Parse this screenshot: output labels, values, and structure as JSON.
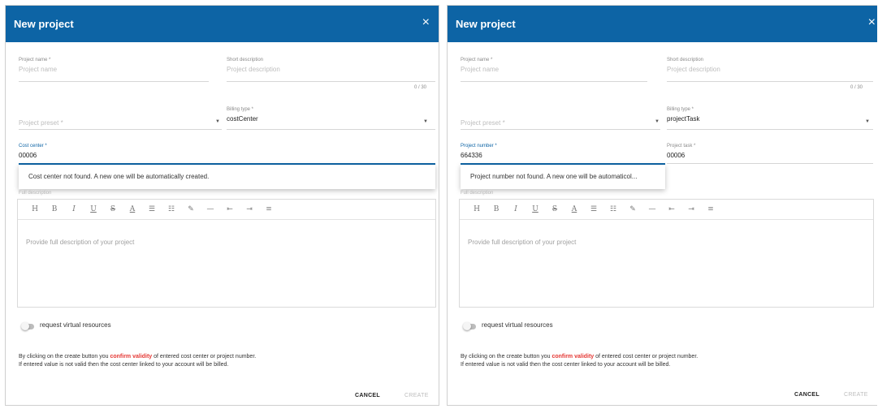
{
  "left": {
    "title": "New project",
    "close_glyph": "×",
    "project_name_label": "Project name *",
    "project_name_placeholder": "Project name",
    "short_desc_label": "Short description",
    "short_desc_placeholder": "Project description",
    "counter": "0 / 30",
    "preset_placeholder": "Project preset *",
    "billing_label": "Billing type *",
    "billing_value": "costCenter",
    "code_label": "Cost center *",
    "code_value": "00006",
    "popup_text": "Cost center not found. A new one will be automatically created.",
    "desc_label": "Full description",
    "editor_placeholder": "Provide full description of your project",
    "toggle_label": "request virtual resources",
    "note_prefix": "By clicking on the create button you ",
    "note_emphasis": "confirm validity",
    "note_suffix": " of entered cost center or project number.",
    "note_line2": "If entered value is not valid then the cost center linked to your account will be billed.",
    "cancel": "CANCEL",
    "create": "CREATE"
  },
  "right": {
    "title": "New project",
    "close_glyph": "×",
    "project_name_label": "Project name *",
    "project_name_placeholder": "Project name",
    "short_desc_label": "Short description",
    "short_desc_placeholder": "Project description",
    "counter": "0 / 30",
    "preset_placeholder": "Project preset *",
    "billing_label": "Billing type *",
    "billing_value": "projectTask",
    "code_label": "Project number *",
    "code_value": "664336",
    "task_label": "Project task *",
    "task_value": "00006",
    "popup_text": "Project number not found. A new one will be automaticol...",
    "desc_label": "Full description",
    "editor_placeholder": "Provide full description of your project",
    "toggle_label": "request virtual resources",
    "note_prefix": "By clicking on the create button you ",
    "note_emphasis": "confirm validity",
    "note_suffix": " of entered cost center or project number.",
    "note_line2": "If entered value is not valid then the cost center linked to your account will be billed.",
    "cancel": "CANCEL",
    "create": "CREATE"
  },
  "toolbar": [
    "H",
    "B",
    "I",
    "U",
    "S",
    "A",
    "☰",
    "☷",
    "✎",
    "—",
    "⇤",
    "⇥",
    "≡"
  ],
  "colors": {
    "header": "#0d64a5",
    "emphasis": "#e53935"
  }
}
